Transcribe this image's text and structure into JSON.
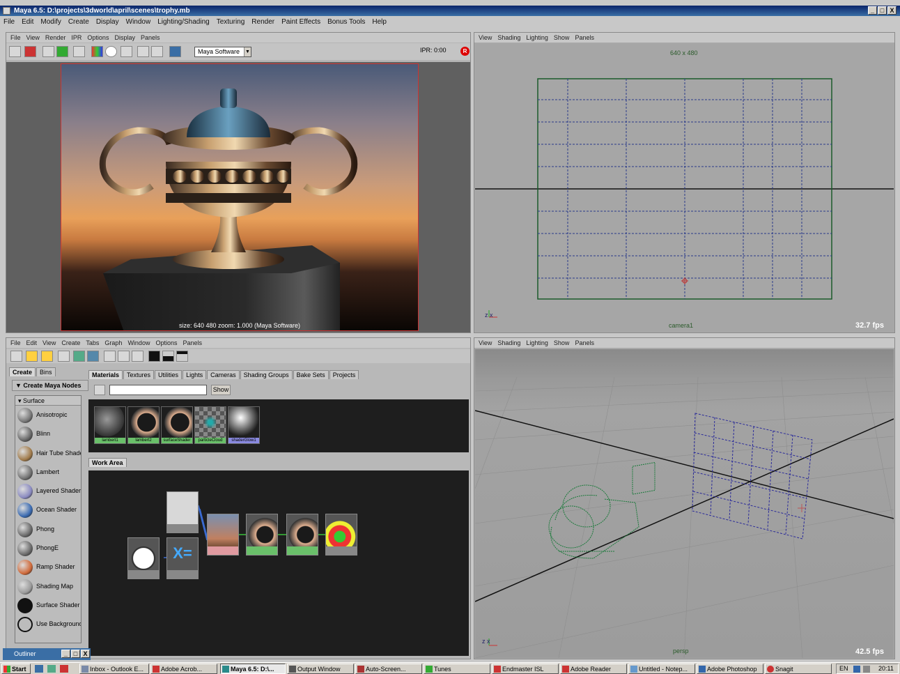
{
  "window": {
    "title": "Maya 6.5: D:\\projects\\3dworld\\april\\scenes\\trophy.mb",
    "controls": [
      "_",
      "□",
      "X"
    ]
  },
  "menubar": [
    "File",
    "Edit",
    "Modify",
    "Create",
    "Display",
    "Window",
    "Lighting/Shading",
    "Texturing",
    "Render",
    "Paint Effects",
    "Bonus Tools",
    "Help"
  ],
  "render_view": {
    "menu": [
      "File",
      "View",
      "Render",
      "IPR",
      "Options",
      "Display",
      "Panels"
    ],
    "renderer": "Maya Software",
    "ipr_label": "IPR: 0:00",
    "info": "size: 640 480 zoom: 1.000 (Maya Software)"
  },
  "front_view": {
    "menu": [
      "View",
      "Shading",
      "Lighting",
      "Show",
      "Panels"
    ],
    "resolution_label": "640 x 480",
    "camera_label": "camera1",
    "fps": "32.7 fps",
    "axis": "z x"
  },
  "hypershade": {
    "menu": [
      "File",
      "Edit",
      "View",
      "Create",
      "Tabs",
      "Graph",
      "Window",
      "Options",
      "Panels"
    ],
    "left_tabs": [
      "Create",
      "Bins"
    ],
    "create_title": "Create Maya Nodes",
    "category": "Surface",
    "nodes": [
      "Anisotropic",
      "Blinn",
      "Hair Tube Shader",
      "Lambert",
      "Layered Shader",
      "Ocean Shader",
      "Phong",
      "PhongE",
      "Ramp Shader",
      "Shading Map",
      "Surface Shader",
      "Use Background"
    ],
    "node_colors": [
      "#777777",
      "#666666",
      "#a07a4a",
      "#707070",
      "#8a8ac0",
      "#3a6ab0",
      "#6a6a6a",
      "#6a6a6a",
      "#d06a3a",
      "#9a9a9a",
      "#111111",
      "#ffffff"
    ],
    "tabs": [
      "Materials",
      "Textures",
      "Utilities",
      "Lights",
      "Cameras",
      "Shading Groups",
      "Bake Sets",
      "Projects"
    ],
    "show_button": "Show",
    "swatches": [
      "lambert1",
      "lambert2",
      "surfaceShader",
      "particleCloud",
      "shaderGlow1"
    ],
    "work_area_tab": "Work Area"
  },
  "persp_view": {
    "menu": [
      "View",
      "Shading",
      "Lighting",
      "Show",
      "Panels"
    ],
    "camera_label": "persp",
    "fps": "42.5 fps",
    "axis": "z x"
  },
  "mini_window": {
    "title": "Outliner",
    "controls": [
      "_",
      "□",
      "X"
    ]
  },
  "taskbar": {
    "start": "Start",
    "tasks": [
      "Inbox - Outlook E...",
      "Adobe Acrob...",
      "Maya 6.5: D:\\...",
      "Output Window",
      "Auto-Screen...",
      "Tunes",
      "Endmaster ISL",
      "Adobe Reader",
      "Untitled - Notep...",
      "Adobe Photoshop",
      "Snagit"
    ],
    "clock": "20:11",
    "lang": "EN"
  }
}
